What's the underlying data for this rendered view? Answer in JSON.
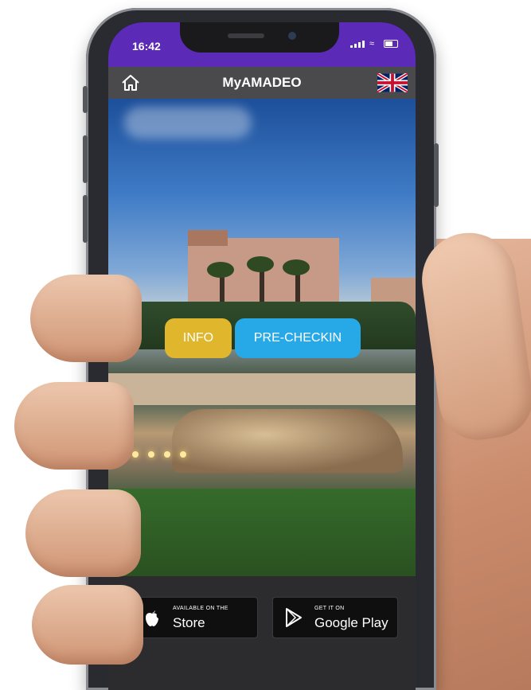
{
  "status_bar": {
    "time": "16:42"
  },
  "app": {
    "title": "MyAMADEO"
  },
  "actions": {
    "info_label": "INFO",
    "precheckin_label": "PRE-CHECKIN"
  },
  "stores": {
    "apple": {
      "small": "AVAILABLE ON THE",
      "big": "Store"
    },
    "google": {
      "small": "GET IT ON",
      "big": "Google Play"
    }
  },
  "colors": {
    "status_bar": "#5b2bb8",
    "header": "#4a4a4c",
    "info": "#e0b62d",
    "precheckin": "#27a9e8"
  }
}
